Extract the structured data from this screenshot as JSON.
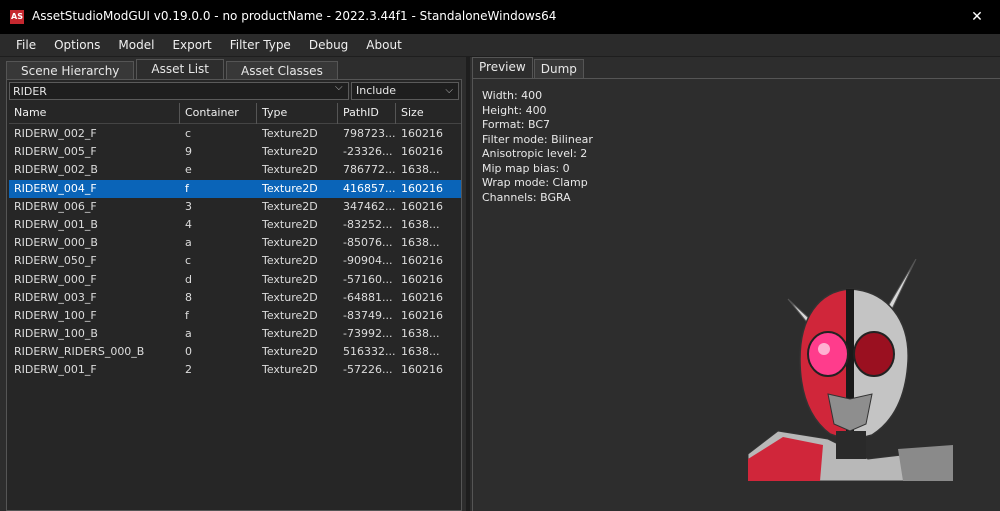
{
  "window": {
    "title": "AssetStudioModGUI v0.19.0.0 - no productName - 2022.3.44f1 - StandaloneWindows64",
    "icon_text": "AS"
  },
  "menu": [
    "File",
    "Options",
    "Model",
    "Export",
    "Filter Type",
    "Debug",
    "About"
  ],
  "left_tabs": [
    "Scene Hierarchy",
    "Asset List",
    "Asset Classes"
  ],
  "filter": {
    "value": "RIDER",
    "mode": "Include"
  },
  "columns": [
    "Name",
    "Container",
    "Type",
    "PathID",
    "Size"
  ],
  "rows": [
    {
      "name": "RIDERW_002_F",
      "container": "c",
      "type": "Texture2D",
      "pathid": "798723...",
      "size": "160216"
    },
    {
      "name": "RIDERW_005_F",
      "container": "9",
      "type": "Texture2D",
      "pathid": "-23326...",
      "size": "160216"
    },
    {
      "name": "RIDERW_002_B",
      "container": "e",
      "type": "Texture2D",
      "pathid": "786772...",
      "size": "1638..."
    },
    {
      "name": "RIDERW_004_F",
      "container": "f",
      "type": "Texture2D",
      "pathid": "416857...",
      "size": "160216"
    },
    {
      "name": "RIDERW_006_F",
      "container": "3",
      "type": "Texture2D",
      "pathid": "347462...",
      "size": "160216"
    },
    {
      "name": "RIDERW_001_B",
      "container": "4",
      "type": "Texture2D",
      "pathid": "-83252...",
      "size": "1638..."
    },
    {
      "name": "RIDERW_000_B",
      "container": "a",
      "type": "Texture2D",
      "pathid": "-85076...",
      "size": "1638..."
    },
    {
      "name": "RIDERW_050_F",
      "container": "c",
      "type": "Texture2D",
      "pathid": "-90904...",
      "size": "160216"
    },
    {
      "name": "RIDERW_000_F",
      "container": "d",
      "type": "Texture2D",
      "pathid": "-57160...",
      "size": "160216"
    },
    {
      "name": "RIDERW_003_F",
      "container": "8",
      "type": "Texture2D",
      "pathid": "-64881...",
      "size": "160216"
    },
    {
      "name": "RIDERW_100_F",
      "container": "f",
      "type": "Texture2D",
      "pathid": "-83749...",
      "size": "160216"
    },
    {
      "name": "RIDERW_100_B",
      "container": "a",
      "type": "Texture2D",
      "pathid": "-73992...",
      "size": "1638..."
    },
    {
      "name": "RIDERW_RIDERS_000_B",
      "container": "0",
      "type": "Texture2D",
      "pathid": "516332...",
      "size": "1638..."
    },
    {
      "name": "RIDERW_001_F",
      "container": "2",
      "type": "Texture2D",
      "pathid": "-57226...",
      "size": "160216"
    }
  ],
  "selected_row_index": 3,
  "right_tabs": [
    "Preview",
    "Dump"
  ],
  "info": [
    "Width: 400",
    "Height: 400",
    "Format: BC7",
    "Filter mode: Bilinear",
    "Anisotropic level: 2",
    "Mip map bias: 0",
    "Wrap mode: Clamp",
    "Channels: BGRA"
  ],
  "colors": {
    "selection": "#0a64b8",
    "helmet_red": "#d0263a",
    "eye_pink": "#ff3c8c"
  }
}
